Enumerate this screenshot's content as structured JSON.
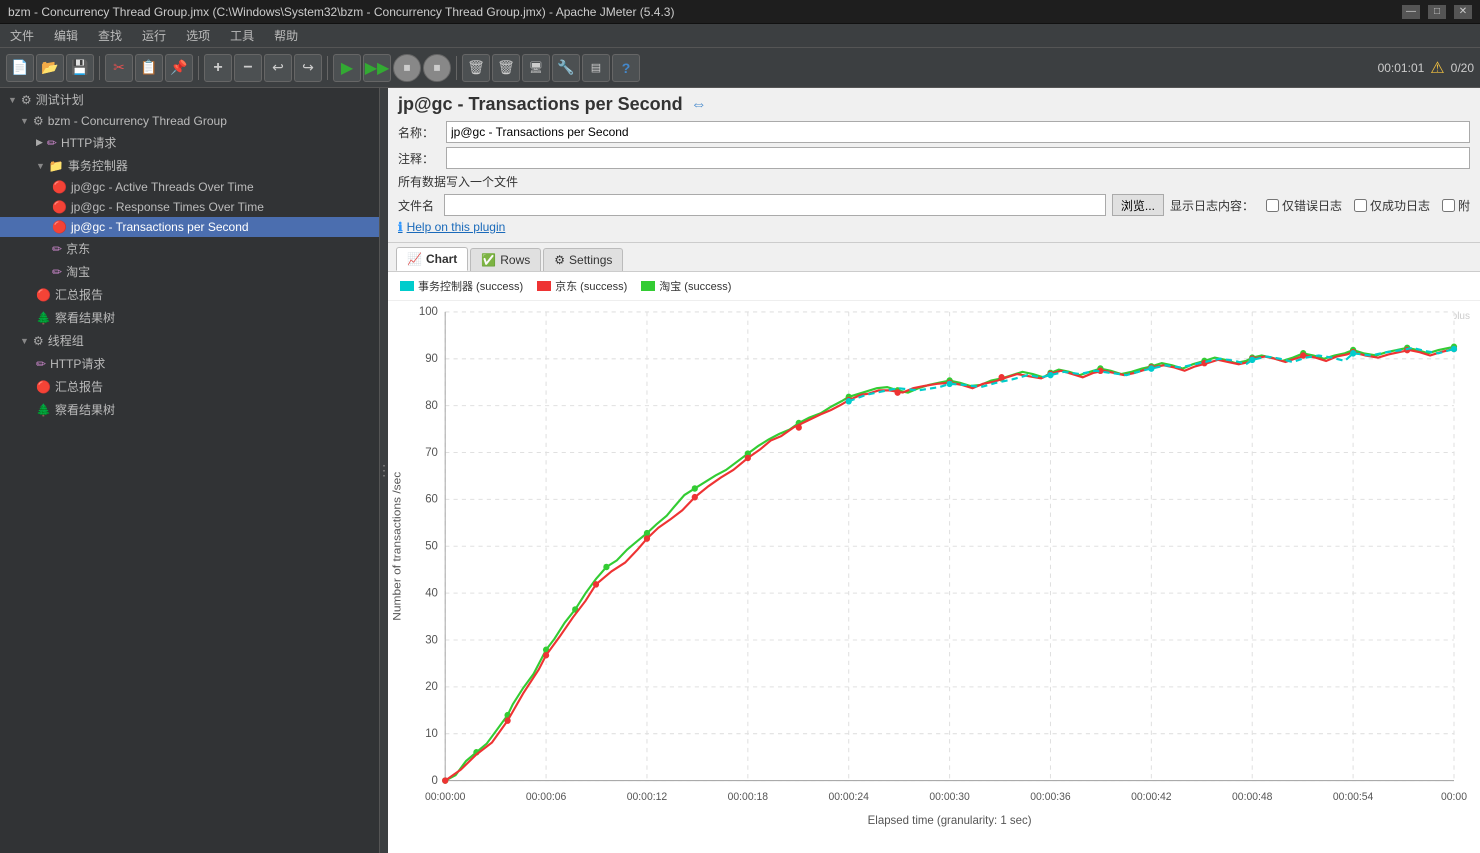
{
  "titleBar": {
    "title": "bzm - Concurrency Thread Group.jmx (C:\\Windows\\System32\\bzm - Concurrency Thread Group.jmx) - Apache JMeter (5.4.3)",
    "timer": "00:01:01",
    "warningIcon": "⚠",
    "counter": "0/20"
  },
  "menuBar": {
    "items": [
      "文件",
      "编辑",
      "查找",
      "运行",
      "选项",
      "工具",
      "帮助"
    ]
  },
  "toolbar": {
    "buttons": [
      {
        "name": "new",
        "icon": "📄"
      },
      {
        "name": "open",
        "icon": "📂"
      },
      {
        "name": "save",
        "icon": "💾"
      },
      {
        "name": "cut",
        "icon": "✂"
      },
      {
        "name": "copy",
        "icon": "📋"
      },
      {
        "name": "paste",
        "icon": "📌"
      },
      {
        "name": "add",
        "icon": "➕"
      },
      {
        "name": "remove",
        "icon": "➖"
      },
      {
        "name": "undo",
        "icon": "↩"
      },
      {
        "name": "redo",
        "icon": "↪"
      },
      {
        "name": "start",
        "icon": "▶"
      },
      {
        "name": "start-no-pause",
        "icon": "⏩"
      },
      {
        "name": "stop",
        "icon": "⏹"
      },
      {
        "name": "shutdown",
        "icon": "⏹"
      },
      {
        "name": "clear",
        "icon": "🗑"
      },
      {
        "name": "clear-all",
        "icon": "🗑"
      },
      {
        "name": "remote",
        "icon": "🖥"
      },
      {
        "name": "function",
        "icon": "🔧"
      },
      {
        "name": "template",
        "icon": "📑"
      },
      {
        "name": "help",
        "icon": "❓"
      }
    ]
  },
  "leftPanel": {
    "rootLabel": "测试计划",
    "tree": [
      {
        "label": "测试计划",
        "indent": 0,
        "icon": "⚙",
        "collapsed": false,
        "type": "root"
      },
      {
        "label": "bzm - Concurrency Thread Group",
        "indent": 1,
        "icon": "⚙",
        "collapsed": false,
        "type": "thread-group"
      },
      {
        "label": "HTTP请求",
        "indent": 2,
        "icon": "✏",
        "type": "sampler"
      },
      {
        "label": "事务控制器",
        "indent": 2,
        "icon": "📁",
        "collapsed": false,
        "type": "controller"
      },
      {
        "label": "jp@gc - Active Threads Over Time",
        "indent": 3,
        "icon": "🔴",
        "type": "listener"
      },
      {
        "label": "jp@gc - Response Times Over Time",
        "indent": 3,
        "icon": "🔴",
        "type": "listener"
      },
      {
        "label": "jp@gc - Transactions per Second",
        "indent": 3,
        "icon": "🔴",
        "type": "listener",
        "selected": true
      },
      {
        "label": "京东",
        "indent": 3,
        "icon": "✏",
        "type": "sampler"
      },
      {
        "label": "淘宝",
        "indent": 3,
        "icon": "✏",
        "type": "sampler"
      },
      {
        "label": "汇总报告",
        "indent": 2,
        "icon": "🔴",
        "type": "listener"
      },
      {
        "label": "察看结果树",
        "indent": 2,
        "icon": "🌲",
        "type": "listener"
      },
      {
        "label": "线程组",
        "indent": 1,
        "icon": "⚙",
        "collapsed": false,
        "type": "thread-group"
      },
      {
        "label": "HTTP请求",
        "indent": 2,
        "icon": "✏",
        "type": "sampler"
      },
      {
        "label": "汇总报告",
        "indent": 2,
        "icon": "🔴",
        "type": "listener"
      },
      {
        "label": "察看结果树",
        "indent": 2,
        "icon": "🌲",
        "type": "listener"
      }
    ]
  },
  "rightPanel": {
    "title": "jp@gc - Transactions per Second",
    "nameLabel": "名称：",
    "nameValue": "jp@gc - Transactions per Second",
    "commentLabel": "注释：",
    "commentValue": "",
    "fileWriteLabel": "所有数据写入一个文件",
    "fileNameLabel": "文件名",
    "fileNameValue": "",
    "browseLabel": "浏览...",
    "displayLogLabel": "显示日志内容：",
    "onlyErrorLabel": "仅错误日志",
    "onlySuccessLabel": "仅成功日志",
    "appendLabel": "附",
    "helpText": "Help on this plugin",
    "tabs": [
      {
        "label": "Chart",
        "icon": "📈",
        "active": true
      },
      {
        "label": "Rows",
        "icon": "✅",
        "active": false
      },
      {
        "label": "Settings",
        "icon": "⚙",
        "active": false
      }
    ],
    "chart": {
      "watermark": "jmeter.plus",
      "yAxisLabel": "Number of transactions /sec",
      "xAxisLabel": "Elapsed time (granularity: 1 sec)",
      "yTicks": [
        "0",
        "10",
        "20",
        "30",
        "40",
        "50",
        "60",
        "70",
        "80",
        "90",
        "100"
      ],
      "xTicks": [
        "00:00:00",
        "00:00:06",
        "00:00:12",
        "00:00:18",
        "00:00:24",
        "00:00:30",
        "00:00:36",
        "00:00:42",
        "00:00:48",
        "00:00:54",
        "00:00"
      ],
      "legend": [
        {
          "label": "事务控制器 (success)",
          "color": "#00cccc"
        },
        {
          "label": "京东 (success)",
          "color": "#ee3333"
        },
        {
          "label": "淘宝 (success)",
          "color": "#33cc33"
        }
      ]
    }
  }
}
